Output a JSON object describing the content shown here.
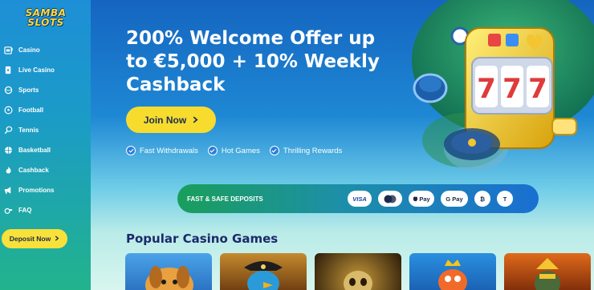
{
  "brand": {
    "logo_line1": "SAMBA",
    "logo_line2": "SLOTS"
  },
  "sidebar": {
    "items": [
      {
        "label": "Casino",
        "icon": "slot-machine-icon"
      },
      {
        "label": "Live Casino",
        "icon": "cards-icon"
      },
      {
        "label": "Sports",
        "icon": "sports-icon"
      },
      {
        "label": "Football",
        "icon": "football-icon"
      },
      {
        "label": "Tennis",
        "icon": "tennis-icon"
      },
      {
        "label": "Basketball",
        "icon": "basketball-icon"
      },
      {
        "label": "Cashback",
        "icon": "flame-icon"
      },
      {
        "label": "Promotions",
        "icon": "megaphone-icon"
      },
      {
        "label": "FAQ",
        "icon": "whistle-icon"
      }
    ],
    "deposit_label": "Deposit Now"
  },
  "hero": {
    "title": "200% Welcome Offer up to €5,000 + 10% Weekly Cashback",
    "cta_label": "Join Now",
    "features": [
      "Fast Withdrawals",
      "Hot Games",
      "Thrilling Rewards"
    ]
  },
  "deposits": {
    "label": "FAST & SAFE DEPOSITS",
    "methods": [
      "VISA",
      "mastercard",
      "Apple Pay",
      "G Pay",
      "Bitcoin",
      "Tether"
    ],
    "method_texts": {
      "visa": "VISA",
      "applepay": "Pay",
      "gpay": "G Pay",
      "bitcoin": "₿",
      "tether": "T"
    }
  },
  "games": {
    "title": "Popular Casino Games",
    "tiles": [
      "dog-game",
      "pirate-parrot-game",
      "skull-game",
      "fish-king-game",
      "warrior-game"
    ]
  },
  "colors": {
    "sidebar_top": "#1e8fd6",
    "sidebar_bottom": "#22b38c",
    "accent_yellow": "#f7dc2e",
    "title_navy": "#1b2a6b"
  }
}
